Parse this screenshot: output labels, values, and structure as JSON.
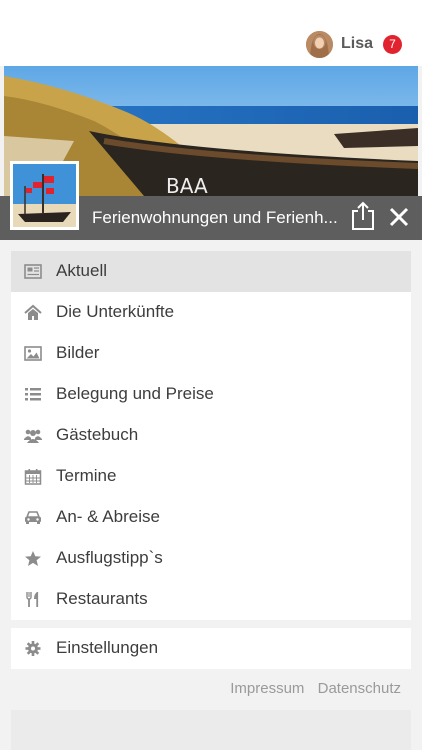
{
  "user": {
    "name": "Lisa",
    "notifications": "7"
  },
  "header": {
    "title": "Ferienwohnungen und Ferienh..."
  },
  "menu": {
    "items": [
      {
        "label": "Aktuell",
        "icon": "newspaper-icon"
      },
      {
        "label": "Die Unterkünfte",
        "icon": "home-icon"
      },
      {
        "label": "Bilder",
        "icon": "image-icon"
      },
      {
        "label": "Belegung und Preise",
        "icon": "list-icon"
      },
      {
        "label": "Gästebuch",
        "icon": "users-icon"
      },
      {
        "label": "Termine",
        "icon": "calendar-icon"
      },
      {
        "label": "An- & Abreise",
        "icon": "car-icon"
      },
      {
        "label": "Ausflugstipp`s",
        "icon": "star-icon"
      },
      {
        "label": "Restaurants",
        "icon": "cutlery-icon"
      }
    ]
  },
  "settings": {
    "label": "Einstellungen",
    "icon": "gear-icon"
  },
  "footer": {
    "impressum": "Impressum",
    "datenschutz": "Datenschutz"
  },
  "colors": {
    "badge": "#e0232e",
    "titlebar": "#5e5e5e",
    "active_item": "#e3e3e3"
  }
}
